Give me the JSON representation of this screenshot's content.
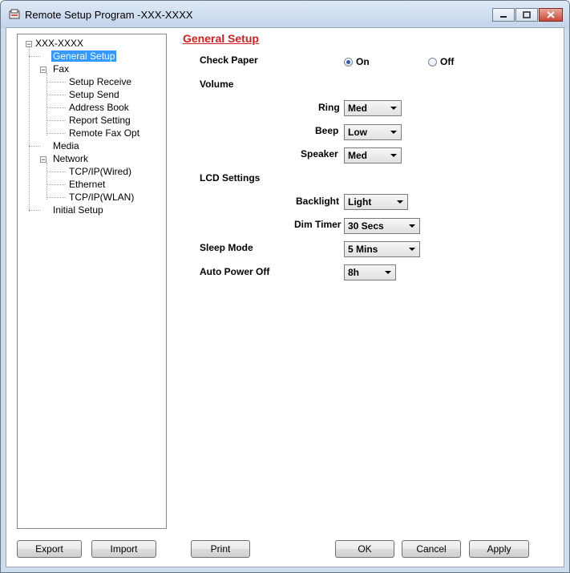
{
  "window": {
    "title": "Remote Setup Program -XXX-XXXX"
  },
  "tree": {
    "root": "XXX-XXXX",
    "items": [
      {
        "label": "General Setup"
      },
      {
        "label": "Fax"
      },
      {
        "label": "Setup Receive"
      },
      {
        "label": "Setup Send"
      },
      {
        "label": "Address Book"
      },
      {
        "label": "Report Setting"
      },
      {
        "label": "Remote Fax Opt"
      },
      {
        "label": "Media"
      },
      {
        "label": "Network"
      },
      {
        "label": "TCP/IP(Wired)"
      },
      {
        "label": "Ethernet"
      },
      {
        "label": "TCP/IP(WLAN)"
      },
      {
        "label": "Initial Setup"
      }
    ],
    "selected": "General Setup"
  },
  "panel": {
    "title": "General Setup",
    "check_paper": {
      "label": "Check Paper",
      "on": "On",
      "off": "Off",
      "value": "On"
    },
    "volume": {
      "label": "Volume",
      "ring": {
        "label": "Ring",
        "value": "Med"
      },
      "beep": {
        "label": "Beep",
        "value": "Low"
      },
      "speaker": {
        "label": "Speaker",
        "value": "Med"
      }
    },
    "lcd": {
      "label": "LCD Settings",
      "backlight": {
        "label": "Backlight",
        "value": "Light"
      },
      "dim_timer": {
        "label": "Dim Timer",
        "value": "30 Secs"
      }
    },
    "sleep_mode": {
      "label": "Sleep Mode",
      "value": "5 Mins"
    },
    "auto_power_off": {
      "label": "Auto Power Off",
      "value": "8h"
    }
  },
  "buttons": {
    "export": "Export",
    "import": "Import",
    "print": "Print",
    "ok": "OK",
    "cancel": "Cancel",
    "apply": "Apply"
  },
  "colors": {
    "accent_title": "#d42020",
    "selection": "#3399ff"
  }
}
